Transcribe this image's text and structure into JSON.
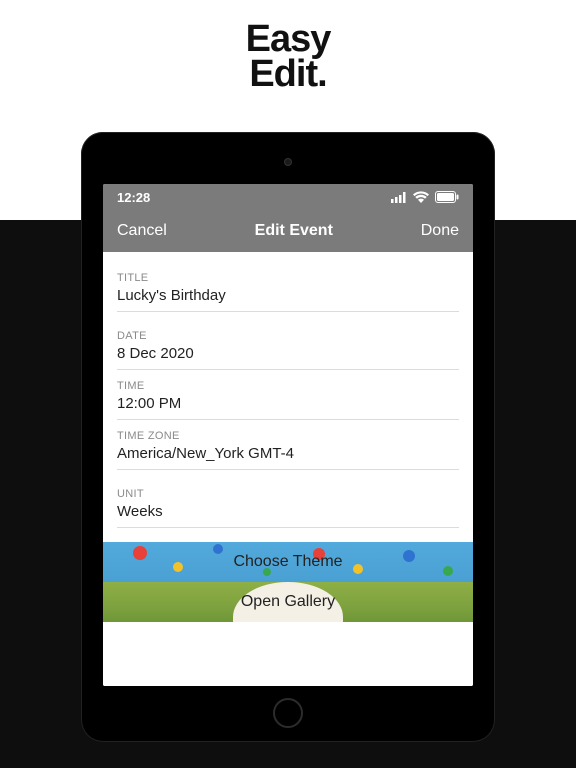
{
  "hero": {
    "line1": "Easy",
    "line2": "Edit."
  },
  "status": {
    "time": "12:28"
  },
  "nav": {
    "cancel": "Cancel",
    "title": "Edit Event",
    "done": "Done"
  },
  "fields": {
    "title_label": "TITLE",
    "title_value": "Lucky's Birthday",
    "date_label": "DATE",
    "date_value": "8 Dec 2020",
    "time_label": "TIME",
    "time_value": "12:00 PM",
    "tz_label": "TIME ZONE",
    "tz_value": "America/New_York GMT-4",
    "unit_label": "UNIT",
    "unit_value": "Weeks"
  },
  "actions": {
    "choose_theme": "Choose Theme",
    "open_gallery": "Open Gallery"
  }
}
